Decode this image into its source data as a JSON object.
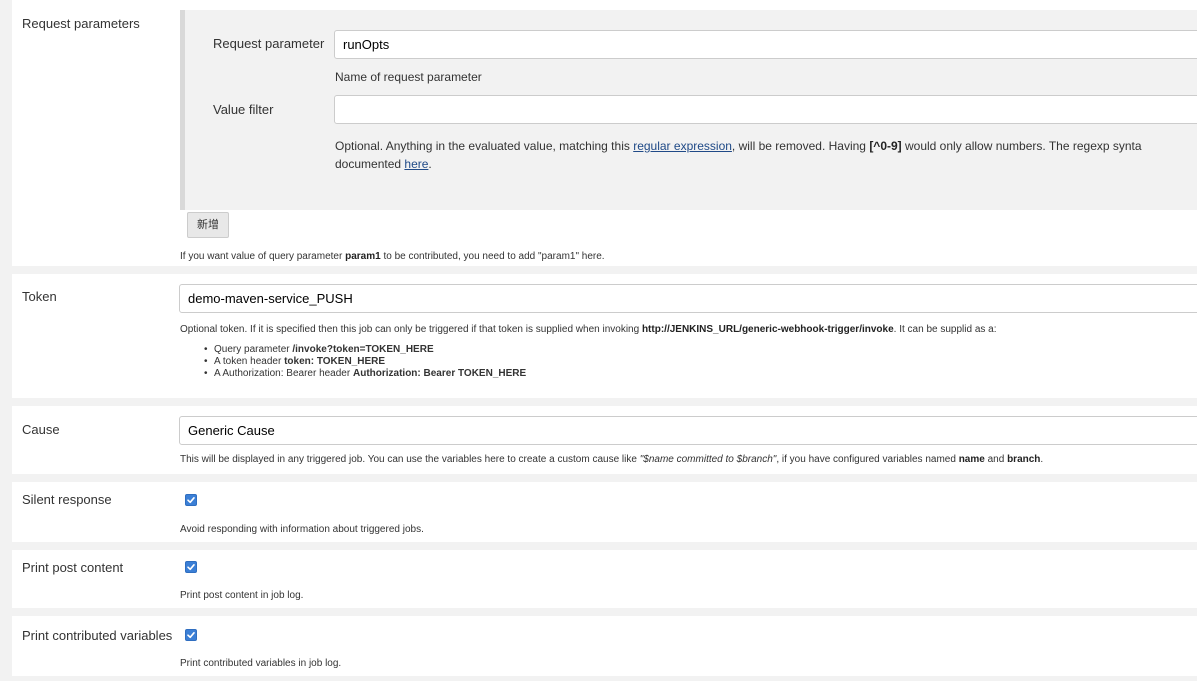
{
  "request_parameters": {
    "label": "Request parameters",
    "param_field_label": "Request parameter",
    "param_value": "runOpts",
    "param_help": "Name of request parameter",
    "value_filter_label": "Value filter",
    "value_filter_value": "",
    "filter_help_1": "Optional. Anything in the evaluated value, matching this ",
    "filter_help_link1": "regular expression",
    "filter_help_2": ", will be removed. Having ",
    "filter_help_bold": "[^0-9]",
    "filter_help_3": " would only allow numbers. The regexp synta",
    "filter_help_4": "documented ",
    "filter_help_link2": "here",
    "filter_help_5": ".",
    "add_button_label": "新增",
    "help_1": "If you want value of query parameter ",
    "help_bold": "param1",
    "help_2": " to be contributed, you need to add \"param1\" here."
  },
  "token": {
    "label": "Token",
    "value": "demo-maven-service_PUSH",
    "help_1": "Optional token. If it is specified then this job can only be triggered if that token is supplied when invoking ",
    "help_bold": "http://JENKINS_URL/generic-webhook-trigger/invoke",
    "help_2": ". It can be supplid as a:",
    "list": [
      {
        "text": "Query parameter ",
        "bold": "/invoke?token=TOKEN_HERE"
      },
      {
        "text": "A token header ",
        "bold": "token: TOKEN_HERE"
      },
      {
        "text": "A Authorization: Bearer header ",
        "bold": "Authorization: Bearer TOKEN_HERE"
      }
    ]
  },
  "cause": {
    "label": "Cause",
    "value": "Generic Cause",
    "help_1": "This will be displayed in any triggered job. You can use the variables here to create a custom cause like ",
    "help_italic": "\"$name committed to $branch\"",
    "help_2": ", if you have configured variables named ",
    "help_bold1": "name",
    "help_3": " and ",
    "help_bold2": "branch",
    "help_4": "."
  },
  "silent_response": {
    "label": "Silent response",
    "checked": true,
    "help": "Avoid responding with information about triggered jobs."
  },
  "print_post_content": {
    "label": "Print post content",
    "checked": true,
    "help": "Print post content in job log."
  },
  "print_contributed_variables": {
    "label": "Print contributed variables",
    "checked": true,
    "help": "Print contributed variables in job log."
  },
  "colors": {
    "checkbox": "#3b7fd6",
    "delete_button": "#d9534f",
    "link": "#204a87"
  }
}
